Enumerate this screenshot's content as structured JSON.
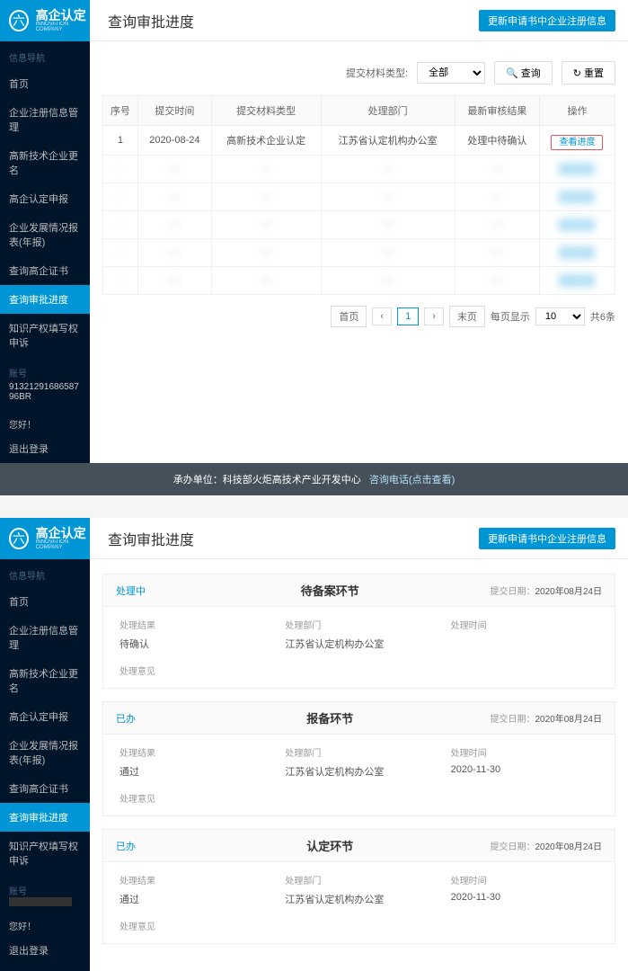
{
  "header": {
    "logo_text": "高企认定",
    "logo_sub": "INNOVATION COMPANY",
    "page_title": "查询审批进度",
    "update_btn": "更新申请书中企业注册信息"
  },
  "sidebar": {
    "section_label": "信息导航",
    "items": [
      "首页",
      "企业注册信息管理",
      "高新技术企业更名",
      "高企认定申报",
      "企业发展情况报表(年报)",
      "查询高企证书",
      "查询审批进度",
      "知识产权填写权申诉"
    ],
    "active_index": 6,
    "account_label": "账号",
    "account_value": "9132129168658796BR",
    "hello": "您好！",
    "logout": "退出登录"
  },
  "filter": {
    "label": "提交材料类型:",
    "value": "全部",
    "search": "查询",
    "reset": "重置"
  },
  "table": {
    "headers": [
      "序号",
      "提交时间",
      "提交材料类型",
      "处理部门",
      "最新审核结果",
      "操作"
    ],
    "row": {
      "no": "1",
      "date": "2020-08-24",
      "type": "高新技术企业认定",
      "dept": "江苏省认定机构办公室",
      "result": "处理中待确认",
      "action": "查看进度"
    }
  },
  "pagination": {
    "first": "首页",
    "prev": "‹",
    "page": "1",
    "next": "›",
    "last": "末页",
    "per_page_label": "每页显示",
    "per_page": "10",
    "total": "共6条"
  },
  "footer": {
    "org": "承办单位：科技部火炬高技术产业开发中心",
    "contact_label": "咨询电话(点击查看)"
  },
  "detail": {
    "cards": [
      {
        "status": "处理中",
        "title": "待备案环节",
        "date_label": "提交日期：",
        "date": "2020年08月24日",
        "result": "待确认",
        "dept": "江苏省认定机构办公室",
        "time": ""
      },
      {
        "status": "已办",
        "title": "报备环节",
        "date_label": "提交日期：",
        "date": "2020年08月24日",
        "result": "通过",
        "dept": "江苏省认定机构办公室",
        "time": "2020-11-30"
      },
      {
        "status": "已办",
        "title": "认定环节",
        "date_label": "提交日期：",
        "date": "2020年08月24日",
        "result": "通过",
        "dept": "江苏省认定机构办公室",
        "time": "2020-11-30"
      }
    ],
    "labels": {
      "result": "处理结果",
      "dept": "处理部门",
      "time": "处理时间",
      "opinion": "处理意见"
    }
  }
}
